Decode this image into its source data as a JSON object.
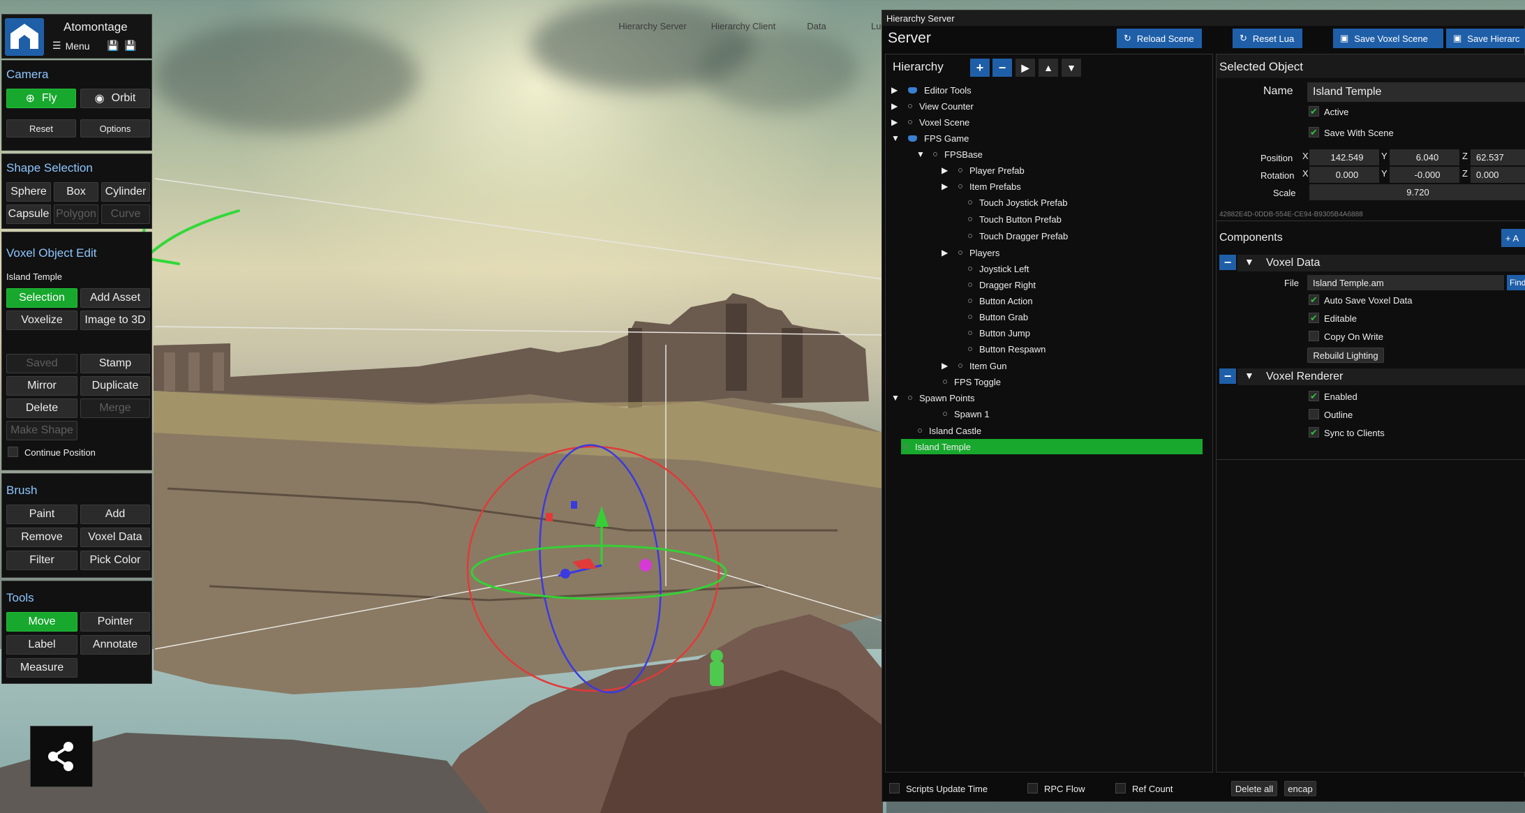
{
  "app": {
    "title": "Atomontage",
    "menu_label": "Menu"
  },
  "top_tabs": [
    "Hierarchy Server",
    "Hierarchy Client",
    "Data",
    "Lu"
  ],
  "left_panel": {
    "camera": {
      "title": "Camera",
      "fly": "Fly",
      "orbit": "Orbit",
      "reset": "Reset",
      "options": "Options"
    },
    "shape_selection": {
      "title": "Shape Selection",
      "items": [
        "Sphere",
        "Box",
        "Cylinder",
        "Capsule",
        "Polygon",
        "Curve"
      ]
    },
    "voxel_edit": {
      "title": "Voxel Object Edit",
      "object_name": "Island Temple",
      "selection": "Selection",
      "add_asset": "Add Asset",
      "voxelize": "Voxelize",
      "image_to_3d": "Image to 3D",
      "saved": "Saved",
      "stamp": "Stamp",
      "mirror": "Mirror",
      "duplicate": "Duplicate",
      "delete": "Delete",
      "merge": "Merge",
      "make_shape": "Make Shape",
      "continue_position": "Continue Position"
    },
    "brush": {
      "title": "Brush",
      "paint": "Paint",
      "add": "Add",
      "remove": "Remove",
      "voxel_data": "Voxel Data",
      "filter": "Filter",
      "pick_color": "Pick Color"
    },
    "tools": {
      "title": "Tools",
      "move": "Move",
      "pointer": "Pointer",
      "label": "Label",
      "annotate": "Annotate",
      "measure": "Measure"
    }
  },
  "server_window": {
    "titlebar": "Hierarchy Server",
    "title": "Server",
    "buttons": {
      "reload": "Reload Scene",
      "reset_lua": "Reset Lua",
      "save_voxel": "Save Voxel Scene",
      "save_hier": "Save Hierarc"
    },
    "hierarchy": {
      "title": "Hierarchy",
      "rows": [
        {
          "label": "Editor Tools",
          "arrow": "▶",
          "icon": "h"
        },
        {
          "label": "View Counter",
          "arrow": "▶",
          "icon": "d"
        },
        {
          "label": "Voxel Scene",
          "arrow": "▶",
          "icon": "d"
        },
        {
          "label": "FPS Game",
          "arrow": "▼",
          "icon": "h"
        },
        {
          "label": "FPSBase",
          "arrow": "▼",
          "icon": "d"
        },
        {
          "label": "Player Prefab",
          "arrow": "▶",
          "icon": "d"
        },
        {
          "label": "Item Prefabs",
          "arrow": "▶",
          "icon": "d"
        },
        {
          "label": "Touch Joystick Prefab",
          "arrow": "",
          "icon": "d"
        },
        {
          "label": "Touch Button Prefab",
          "arrow": "",
          "icon": "d"
        },
        {
          "label": "Touch Dragger Prefab",
          "arrow": "",
          "icon": "d"
        },
        {
          "label": "Players",
          "arrow": "▶",
          "icon": "d"
        },
        {
          "label": "Joystick Left",
          "arrow": "",
          "icon": "d"
        },
        {
          "label": "Dragger Right",
          "arrow": "",
          "icon": "d"
        },
        {
          "label": "Button Action",
          "arrow": "",
          "icon": "d"
        },
        {
          "label": "Button Grab",
          "arrow": "",
          "icon": "d"
        },
        {
          "label": "Button Jump",
          "arrow": "",
          "icon": "d"
        },
        {
          "label": "Button Respawn",
          "arrow": "",
          "icon": "d"
        },
        {
          "label": "Item Gun",
          "arrow": "▶",
          "icon": "d"
        },
        {
          "label": "FPS Toggle",
          "arrow": "",
          "icon": "d"
        },
        {
          "label": "Spawn Points",
          "arrow": "▼",
          "icon": "d"
        },
        {
          "label": "Spawn 1",
          "arrow": "",
          "icon": "d"
        },
        {
          "label": "Island Castle",
          "arrow": "",
          "icon": "d"
        },
        {
          "label": "Island Temple",
          "arrow": "",
          "icon": "d",
          "selected": true
        }
      ]
    },
    "selected": {
      "title": "Selected Object",
      "name_label": "Name",
      "name": "Island Temple",
      "active": "Active",
      "save_with_scene": "Save With Scene",
      "position_label": "Position",
      "rotation_label": "Rotation",
      "scale_label": "Scale",
      "px": "142.549",
      "py": "6.040",
      "pz": "62.537",
      "rx": "0.000",
      "ry": "-0.000",
      "rz": "0.000",
      "scale": "9.720",
      "x": "X",
      "y": "Y",
      "z": "Z",
      "uuid": "42882E4D-0DDB-554E-CE94-B9305B4A6888",
      "components_title": "Components",
      "add_label": "+ A",
      "voxel_data": {
        "title": "Voxel Data",
        "file_label": "File",
        "file": "Island Temple.am",
        "find": "Find",
        "auto_save": "Auto Save Voxel Data",
        "editable": "Editable",
        "copy_on_write": "Copy On Write",
        "rebuild": "Rebuild Lighting"
      },
      "voxel_renderer": {
        "title": "Voxel Renderer",
        "enabled": "Enabled",
        "outline": "Outline",
        "sync": "Sync to Clients"
      }
    },
    "status_bar": {
      "scripts": "Scripts Update Time",
      "rpc": "RPC Flow",
      "ref": "Ref Count",
      "delete_all": "Delete all",
      "encap": "encap"
    }
  },
  "colors": {
    "accent_green": "#17a82d",
    "blue_button": "#1f5fa8",
    "section_blue": "#8ec6ff",
    "annotation_green": "#32d83a"
  }
}
